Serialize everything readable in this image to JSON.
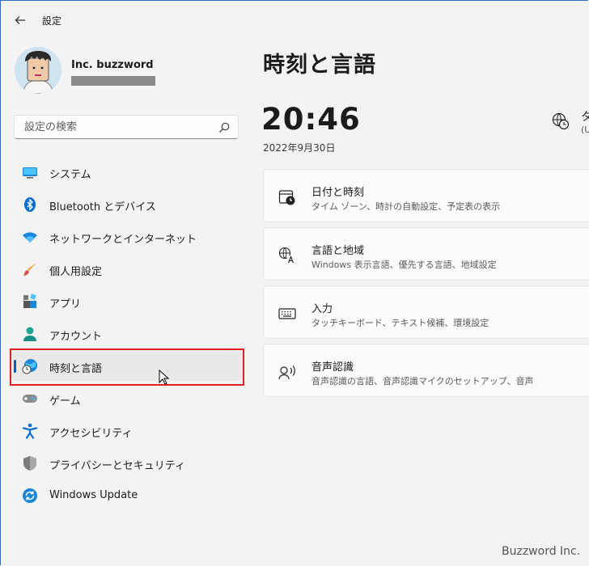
{
  "window": {
    "title": "設定"
  },
  "profile": {
    "name": "Inc. buzzword"
  },
  "search": {
    "placeholder": "設定の検索"
  },
  "sidebar": {
    "items": [
      {
        "label": "システム"
      },
      {
        "label": "Bluetooth とデバイス"
      },
      {
        "label": "ネットワークとインターネット"
      },
      {
        "label": "個人用設定"
      },
      {
        "label": "アプリ"
      },
      {
        "label": "アカウント"
      },
      {
        "label": "時刻と言語"
      },
      {
        "label": "ゲーム"
      },
      {
        "label": "アクセシビリティ"
      },
      {
        "label": "プライバシーとセキュリティ"
      },
      {
        "label": "Windows Update"
      }
    ],
    "selected_index": 6
  },
  "main": {
    "title": "時刻と言語",
    "clock": {
      "time": "20:46",
      "date": "2022年9月30日"
    },
    "timezone": {
      "label": "タ",
      "sub": "(U"
    },
    "cards": [
      {
        "title": "日付と時刻",
        "subtitle": "タイム ゾーン、時計の自動設定、予定表の表示",
        "icon": "calendar-clock-icon"
      },
      {
        "title": "言語と地域",
        "subtitle": "Windows 表示言語、優先する言語、地域設定",
        "icon": "language-icon"
      },
      {
        "title": "入力",
        "subtitle": "タッチキーボード、テキスト候補、環境設定",
        "icon": "keyboard-icon"
      },
      {
        "title": "音声認識",
        "subtitle": "音声認識の言語、音声認識マイクのセットアップ、音声",
        "icon": "speech-icon"
      }
    ]
  },
  "watermark": "Buzzword Inc.",
  "colors": {
    "accent": "#005fb8",
    "highlight": "#e01e23",
    "background": "#f3f3f3"
  }
}
